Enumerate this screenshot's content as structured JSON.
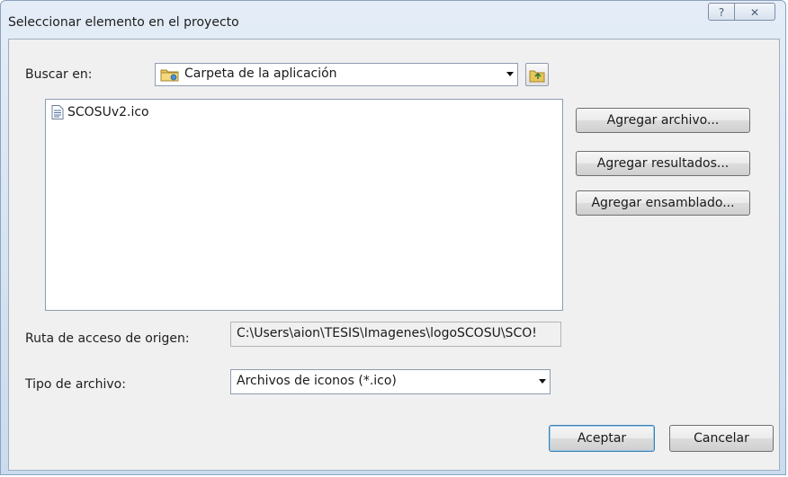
{
  "window": {
    "title": "Seleccionar elemento en el proyecto",
    "help_label": "?",
    "close_label": "✕"
  },
  "lookin": {
    "label": "Buscar en:",
    "value": "Carpeta de la aplicación"
  },
  "files": [
    {
      "name": "SCOSUv2.ico"
    }
  ],
  "buttons": {
    "add_file": "Agregar archivo...",
    "add_results": "Agregar resultados...",
    "add_assembly": "Agregar ensamblado...",
    "accept": "Aceptar",
    "cancel": "Cancelar"
  },
  "source_path": {
    "label": "Ruta de acceso de origen:",
    "value": "C:\\Users\\aion\\TESIS\\Imagenes\\logoSCOSU\\SCO!"
  },
  "file_type": {
    "label": "Tipo de archivo:",
    "value": "Archivos de iconos (*.ico)"
  },
  "colors": {
    "accent_border": "#3c7fb1",
    "titlebar": "#c9dbee"
  }
}
